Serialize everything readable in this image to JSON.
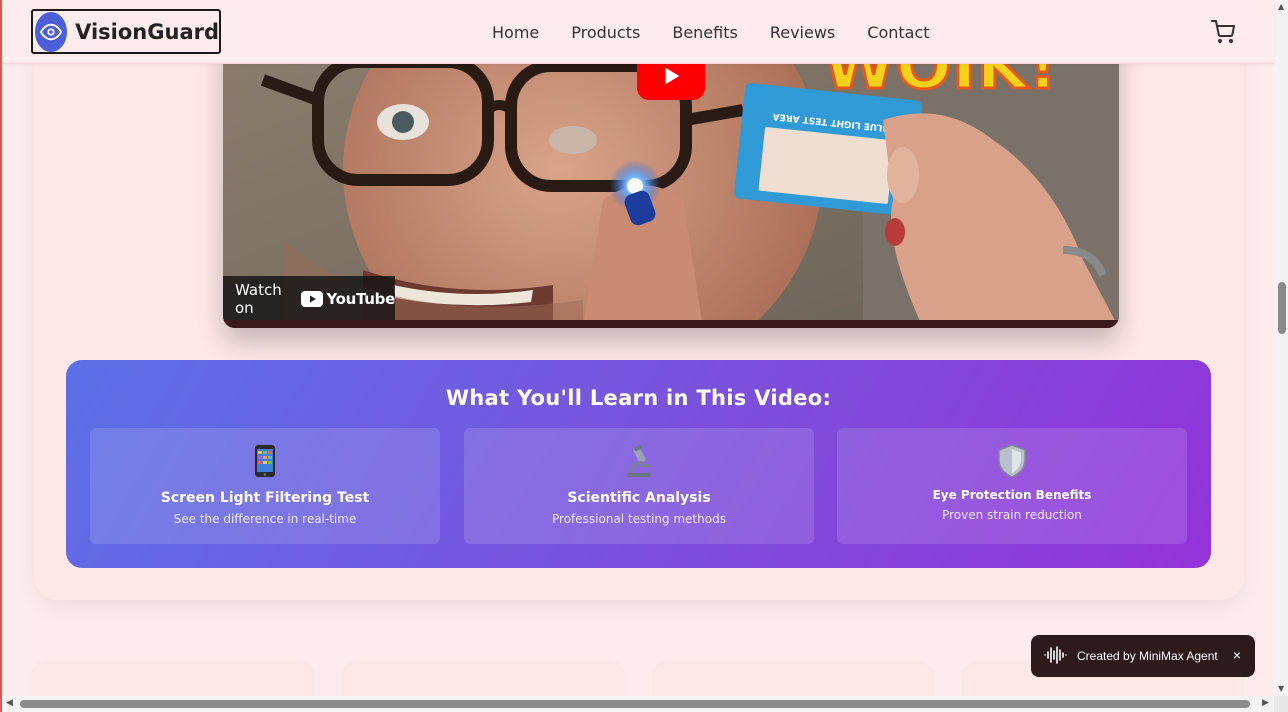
{
  "brand": {
    "name": "VisionGuard",
    "accent": "#4c5fd8"
  },
  "nav": {
    "links": [
      "Home",
      "Products",
      "Benefits",
      "Reviews",
      "Contact"
    ],
    "cart_icon": "cart-icon"
  },
  "video": {
    "headline_fragment": "WOIK!",
    "card_label": "BLUE LIGHT TEST AREA",
    "watch_on": "Watch on",
    "youtube": "YouTube"
  },
  "learn": {
    "title": "What You'll Learn in This Video:",
    "features": [
      {
        "icon": "phone-icon",
        "title": "Screen Light Filtering Test",
        "subtitle": "See the difference in real-time"
      },
      {
        "icon": "microscope-icon",
        "title": "Scientific Analysis",
        "subtitle": "Professional testing methods"
      },
      {
        "icon": "shield-icon",
        "title": "Eye Protection Benefits",
        "subtitle": "Proven strain reduction"
      }
    ]
  },
  "toast": {
    "label": "Created by MiniMax Agent",
    "close": "×"
  },
  "colors": {
    "page_bg": "#fdeceb",
    "gradient_start": "#5b70e6",
    "gradient_end": "#9333d9",
    "youtube_red": "#ff0000",
    "toast_bg": "#2d1b1b"
  }
}
